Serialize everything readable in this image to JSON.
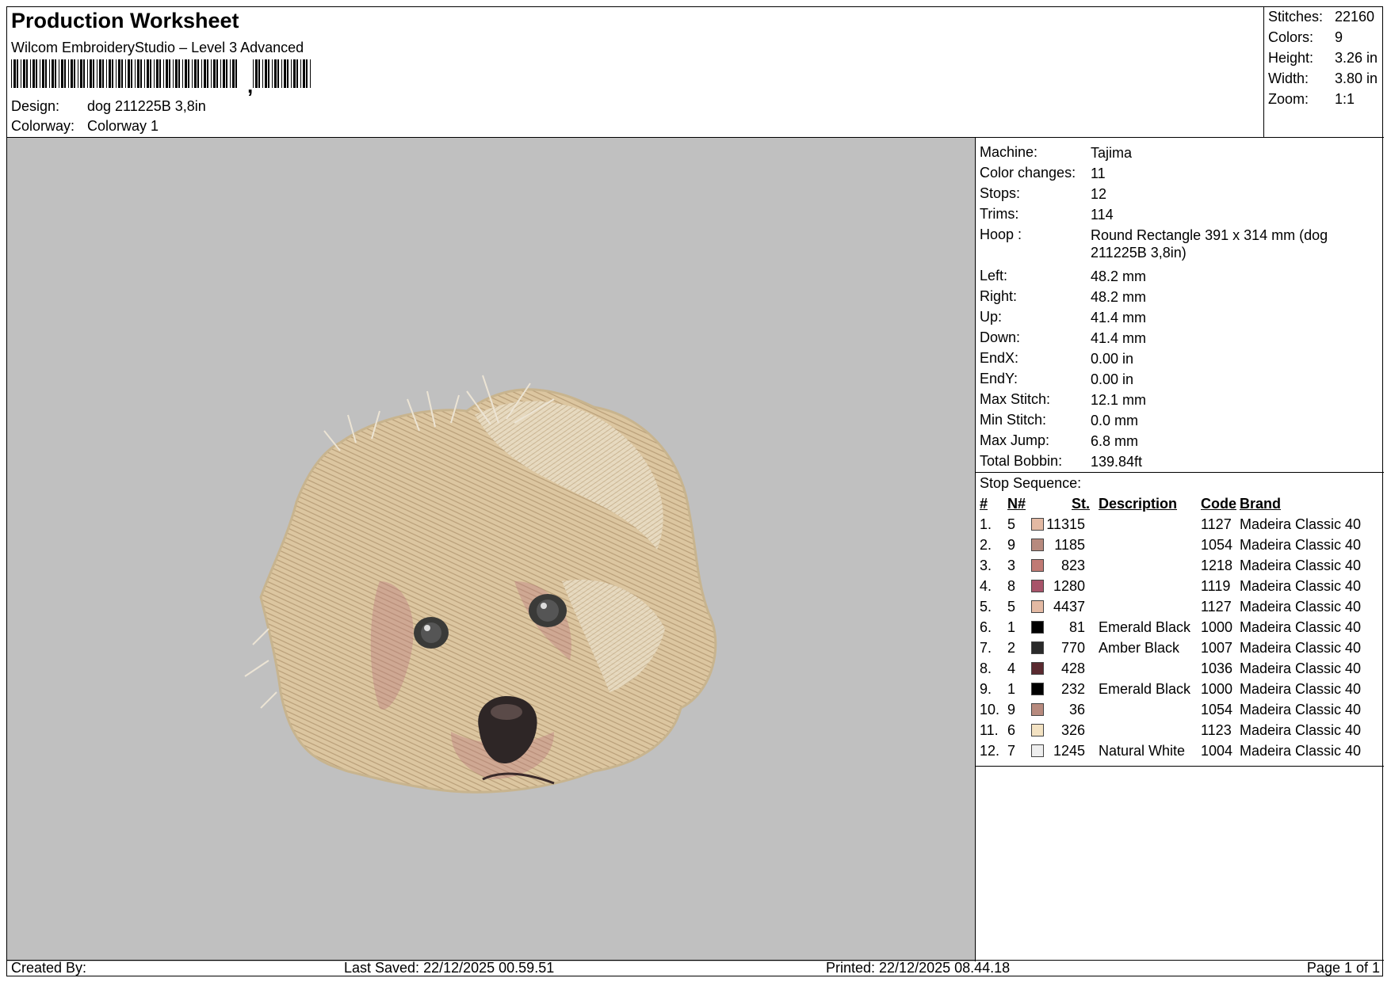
{
  "header": {
    "title": "Production Worksheet",
    "software": "Wilcom EmbroideryStudio – Level 3 Advanced",
    "barcode_separator": ",",
    "design_label": "Design:",
    "design_value": "dog 211225B 3,8in",
    "colorway_label": "Colorway:",
    "colorway_value": "Colorway 1"
  },
  "stats": [
    {
      "label": "Stitches:",
      "value": "22160"
    },
    {
      "label": "Colors:",
      "value": "9"
    },
    {
      "label": "Height:",
      "value": "3.26 in"
    },
    {
      "label": "Width:",
      "value": "3.80 in"
    },
    {
      "label": "Zoom:",
      "value": "1:1"
    }
  ],
  "machine_info": [
    {
      "label": "Machine:",
      "value": "Tajima"
    },
    {
      "label": "Color changes:",
      "value": "11"
    },
    {
      "label": "Stops:",
      "value": "12"
    },
    {
      "label": "Trims:",
      "value": "114"
    },
    {
      "label": "Hoop :",
      "value": "Round Rectangle 391 x 314 mm (dog 211225B 3,8in)"
    },
    {
      "label": "Left:",
      "value": "48.2 mm"
    },
    {
      "label": "Right:",
      "value": "48.2 mm"
    },
    {
      "label": "Up:",
      "value": "41.4 mm"
    },
    {
      "label": "Down:",
      "value": "41.4 mm"
    },
    {
      "label": "EndX:",
      "value": "0.00 in"
    },
    {
      "label": "EndY:",
      "value": "0.00 in"
    },
    {
      "label": "Max Stitch:",
      "value": "12.1 mm"
    },
    {
      "label": "Min Stitch:",
      "value": "0.0 mm"
    },
    {
      "label": "Max Jump:",
      "value": "6.8 mm"
    },
    {
      "label": "Total Bobbin:",
      "value": "139.84ft"
    }
  ],
  "stop_sequence": {
    "title": "Stop Sequence:",
    "columns": {
      "num": "#",
      "n": "N#",
      "st": "St.",
      "desc": "Description",
      "code": "Code",
      "brand": "Brand"
    },
    "rows": [
      {
        "num": "1.",
        "n": "5",
        "color": "#e3b9a3",
        "st": "11315",
        "desc": "",
        "code": "1127",
        "brand": "Madeira Classic 40"
      },
      {
        "num": "2.",
        "n": "9",
        "color": "#b78a7e",
        "st": "1185",
        "desc": "",
        "code": "1054",
        "brand": "Madeira Classic 40"
      },
      {
        "num": "3.",
        "n": "3",
        "color": "#c07a74",
        "st": "823",
        "desc": "",
        "code": "1218",
        "brand": "Madeira Classic 40"
      },
      {
        "num": "4.",
        "n": "8",
        "color": "#a8546a",
        "st": "1280",
        "desc": "",
        "code": "1119",
        "brand": "Madeira Classic 40"
      },
      {
        "num": "5.",
        "n": "5",
        "color": "#e3b9a3",
        "st": "4437",
        "desc": "",
        "code": "1127",
        "brand": "Madeira Classic 40"
      },
      {
        "num": "6.",
        "n": "1",
        "color": "#000000",
        "st": "81",
        "desc": "Emerald Black",
        "code": "1000",
        "brand": "Madeira Classic 40"
      },
      {
        "num": "7.",
        "n": "2",
        "color": "#2a2a2a",
        "st": "770",
        "desc": "Amber Black",
        "code": "1007",
        "brand": "Madeira Classic 40"
      },
      {
        "num": "8.",
        "n": "4",
        "color": "#5a2a30",
        "st": "428",
        "desc": "",
        "code": "1036",
        "brand": "Madeira Classic 40"
      },
      {
        "num": "9.",
        "n": "1",
        "color": "#000000",
        "st": "232",
        "desc": "Emerald Black",
        "code": "1000",
        "brand": "Madeira Classic 40"
      },
      {
        "num": "10.",
        "n": "9",
        "color": "#b78a7e",
        "st": "36",
        "desc": "",
        "code": "1054",
        "brand": "Madeira Classic 40"
      },
      {
        "num": "11.",
        "n": "6",
        "color": "#f3e2c2",
        "st": "326",
        "desc": "",
        "code": "1123",
        "brand": "Madeira Classic 40"
      },
      {
        "num": "12.",
        "n": "7",
        "color": "#eeeeee",
        "st": "1245",
        "desc": "Natural White",
        "code": "1004",
        "brand": "Madeira Classic 40"
      }
    ]
  },
  "footer": {
    "created_by": "Created By:",
    "last_saved": "Last Saved: 22/12/2025 00.59.51",
    "printed": "Printed: 22/12/2025 08.44.18",
    "page": "Page 1 of 1"
  }
}
